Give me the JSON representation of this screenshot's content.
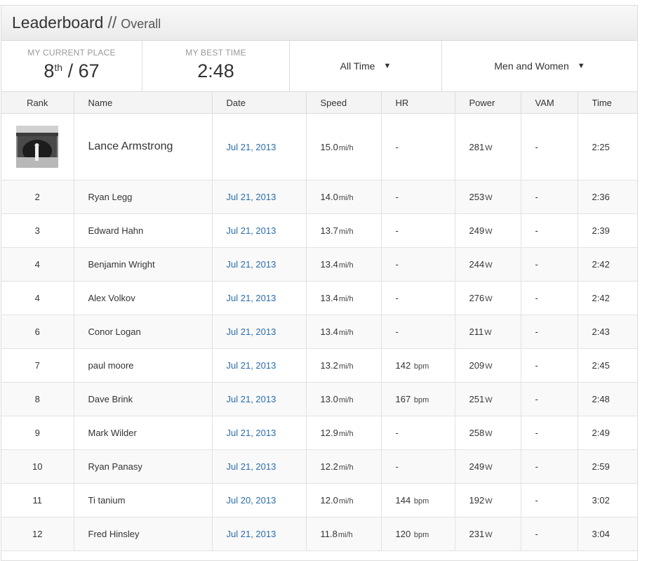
{
  "header": {
    "title": "Leaderboard",
    "separator": "//",
    "subtitle": "Overall"
  },
  "stats": {
    "place_label": "MY CURRENT PLACE",
    "place_rank": "8",
    "place_suffix": "th",
    "place_total": " / 67",
    "best_label": "MY BEST TIME",
    "best_value": "2:48"
  },
  "filters": {
    "period": "All Time",
    "gender": "Men and Women",
    "caret": "▼"
  },
  "columns": [
    "Rank",
    "Name",
    "Date",
    "Speed",
    "HR",
    "Power",
    "VAM",
    "Time"
  ],
  "units": {
    "speed": "mi/h",
    "hr": "bpm",
    "power": "W"
  },
  "rows": [
    {
      "rank": "",
      "name": "Lance Armstrong",
      "date": "Jul 21, 2013",
      "speed": "15.0",
      "hr": "-",
      "hr_unit": "",
      "power": "281",
      "vam": "-",
      "time": "2:25"
    },
    {
      "rank": "2",
      "name": "Ryan Legg",
      "date": "Jul 21, 2013",
      "speed": "14.0",
      "hr": "-",
      "hr_unit": "",
      "power": "253",
      "vam": "-",
      "time": "2:36"
    },
    {
      "rank": "3",
      "name": "Edward Hahn",
      "date": "Jul 21, 2013",
      "speed": "13.7",
      "hr": "-",
      "hr_unit": "",
      "power": "249",
      "vam": "-",
      "time": "2:39"
    },
    {
      "rank": "4",
      "name": "Benjamin Wright",
      "date": "Jul 21, 2013",
      "speed": "13.4",
      "hr": "-",
      "hr_unit": "",
      "power": "244",
      "vam": "-",
      "time": "2:42"
    },
    {
      "rank": "4",
      "name": "Alex Volkov",
      "date": "Jul 21, 2013",
      "speed": "13.4",
      "hr": "-",
      "hr_unit": "",
      "power": "276",
      "vam": "-",
      "time": "2:42"
    },
    {
      "rank": "6",
      "name": "Conor Logan",
      "date": "Jul 21, 2013",
      "speed": "13.4",
      "hr": "-",
      "hr_unit": "",
      "power": "211",
      "vam": "-",
      "time": "2:43"
    },
    {
      "rank": "7",
      "name": "paul moore",
      "date": "Jul 21, 2013",
      "speed": "13.2",
      "hr": "142",
      "hr_unit": "bpm",
      "power": "209",
      "vam": "-",
      "time": "2:45"
    },
    {
      "rank": "8",
      "name": "Dave Brink",
      "date": "Jul 21, 2013",
      "speed": "13.0",
      "hr": "167",
      "hr_unit": "bpm",
      "power": "251",
      "vam": "-",
      "time": "2:48"
    },
    {
      "rank": "9",
      "name": "Mark Wilder",
      "date": "Jul 21, 2013",
      "speed": "12.9",
      "hr": "-",
      "hr_unit": "",
      "power": "258",
      "vam": "-",
      "time": "2:49"
    },
    {
      "rank": "10",
      "name": "Ryan Panasy",
      "date": "Jul 21, 2013",
      "speed": "12.2",
      "hr": "-",
      "hr_unit": "",
      "power": "249",
      "vam": "-",
      "time": "2:59"
    },
    {
      "rank": "11",
      "name": "Ti tanium",
      "date": "Jul 20, 2013",
      "speed": "12.0",
      "hr": "144",
      "hr_unit": "bpm",
      "power": "192",
      "vam": "-",
      "time": "3:02"
    },
    {
      "rank": "12",
      "name": "Fred Hinsley",
      "date": "Jul 21, 2013",
      "speed": "11.8",
      "hr": "120",
      "hr_unit": "bpm",
      "power": "231",
      "vam": "-",
      "time": "3:04"
    }
  ]
}
